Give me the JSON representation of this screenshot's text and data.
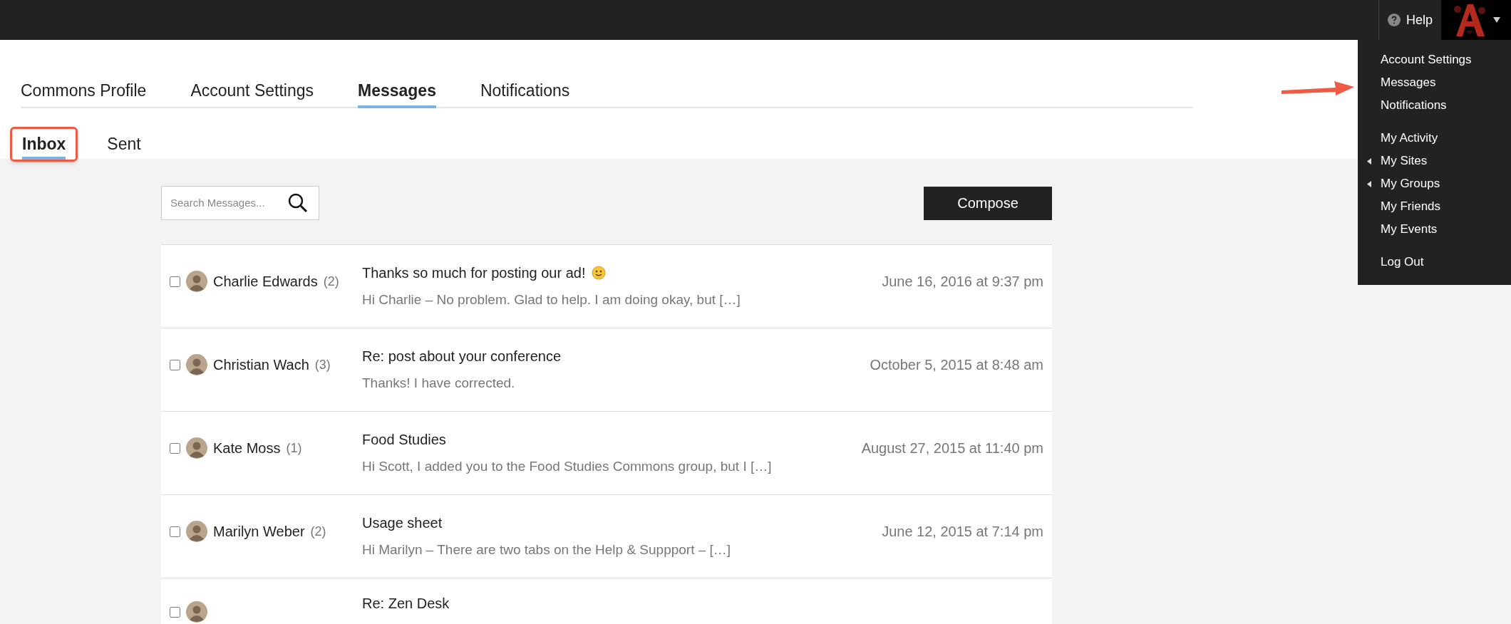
{
  "top_bar": {
    "help": "Help"
  },
  "user_menu": {
    "groups": [
      [
        {
          "label": "Account Settings",
          "submenu": false
        },
        {
          "label": "Messages",
          "submenu": false
        },
        {
          "label": "Notifications",
          "submenu": false
        }
      ],
      [
        {
          "label": "My Activity",
          "submenu": false
        },
        {
          "label": "My Sites",
          "submenu": true
        },
        {
          "label": "My Groups",
          "submenu": true
        },
        {
          "label": "My Friends",
          "submenu": false
        },
        {
          "label": "My Events",
          "submenu": false
        }
      ],
      [
        {
          "label": "Log Out",
          "submenu": false
        }
      ]
    ]
  },
  "tabs": [
    {
      "label": "Commons Profile",
      "selected": false
    },
    {
      "label": "Account Settings",
      "selected": false
    },
    {
      "label": "Messages",
      "selected": true
    },
    {
      "label": "Notifications",
      "selected": false
    }
  ],
  "subtabs": [
    {
      "label": "Inbox",
      "selected": true,
      "highlighted": true
    },
    {
      "label": "Sent",
      "selected": false,
      "highlighted": false
    }
  ],
  "search": {
    "placeholder": "Search Messages..."
  },
  "compose": "Compose",
  "messages": [
    {
      "checked": false,
      "name": "Charlie Edwards",
      "count": "(2)",
      "subject": "Thanks so much for posting our ad!",
      "smiley": true,
      "excerpt": "Hi Charlie – No problem. Glad to help. I am doing okay, but […]",
      "date": "June 16, 2016 at 9:37 pm"
    },
    {
      "checked": false,
      "name": "Christian Wach",
      "count": "(3)",
      "subject": "Re: post about your conference",
      "smiley": false,
      "excerpt": "Thanks! I have corrected.",
      "date": "October 5, 2015 at 8:48 am"
    },
    {
      "checked": false,
      "name": "Kate Moss",
      "count": "(1)",
      "subject": "Food Studies",
      "smiley": false,
      "excerpt": "Hi Scott, I added you to the Food Studies Commons group, but I […]",
      "date": "August 27, 2015 at 11:40 pm"
    },
    {
      "checked": false,
      "name": "Marilyn Weber",
      "count": "(2)",
      "subject": "Usage sheet",
      "smiley": false,
      "excerpt": "Hi Marilyn – There are two tabs on the Help & Suppport – […]",
      "date": "June 12, 2015 at 7:14 pm"
    },
    {
      "checked": false,
      "subject": "Re: Zen Desk",
      "smiley": false
    }
  ]
}
